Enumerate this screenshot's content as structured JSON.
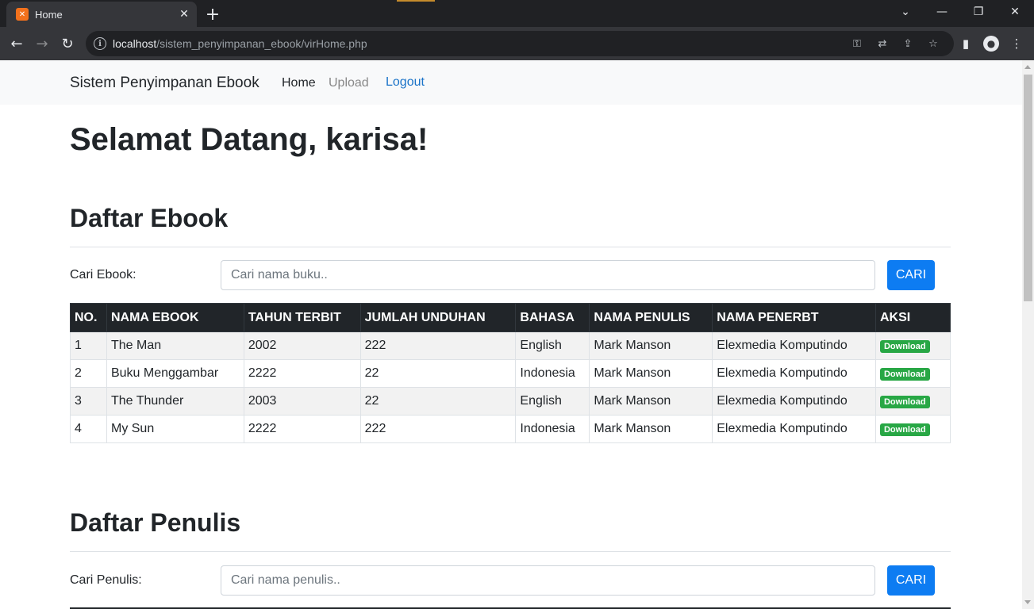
{
  "browser": {
    "tab_title": "Home",
    "tab_favicon": "xampp-icon",
    "url_host": "localhost",
    "url_path": "/sistem_penyimpanan_ebook/virHome.php"
  },
  "navbar": {
    "brand": "Sistem Penyimpanan Ebook",
    "links": [
      {
        "label": "Home",
        "color": "#212529"
      },
      {
        "label": "Upload",
        "color": "#888888"
      },
      {
        "label": "Logout",
        "color": "#0d6efd"
      }
    ]
  },
  "welcome": "Selamat Datang, karisa!",
  "ebook_section": {
    "title": "Daftar Ebook",
    "search_label": "Cari Ebook:",
    "search_placeholder": "Cari nama buku..",
    "search_button": "CARI",
    "headers": [
      "NO.",
      "NAMA EBOOK",
      "TAHUN TERBIT",
      "JUMLAH UNDUHAN",
      "BAHASA",
      "NAMA PENULIS",
      "NAMA PENERBT",
      "AKSI"
    ],
    "rows": [
      {
        "no": "1",
        "nama": "The Man",
        "tahun": "2002",
        "unduhan": "222",
        "bahasa": "English",
        "penulis": "Mark Manson",
        "penerbit": "Elexmedia Komputindo",
        "aksi": "Download"
      },
      {
        "no": "2",
        "nama": "Buku Menggambar",
        "tahun": "2222",
        "unduhan": "22",
        "bahasa": "Indonesia",
        "penulis": "Mark Manson",
        "penerbit": "Elexmedia Komputindo",
        "aksi": "Download"
      },
      {
        "no": "3",
        "nama": "The Thunder",
        "tahun": "2003",
        "unduhan": "22",
        "bahasa": "English",
        "penulis": "Mark Manson",
        "penerbit": "Elexmedia Komputindo",
        "aksi": "Download"
      },
      {
        "no": "4",
        "nama": "My Sun",
        "tahun": "2222",
        "unduhan": "222",
        "bahasa": "Indonesia",
        "penulis": "Mark Manson",
        "penerbit": "Elexmedia Komputindo",
        "aksi": "Download"
      }
    ]
  },
  "penulis_section": {
    "title": "Daftar Penulis",
    "search_label": "Cari Penulis:",
    "search_placeholder": "Cari nama penulis..",
    "search_button": "CARI"
  },
  "colors": {
    "primary": "#0d7cf2",
    "success": "#28a745",
    "table_header": "#212529"
  }
}
